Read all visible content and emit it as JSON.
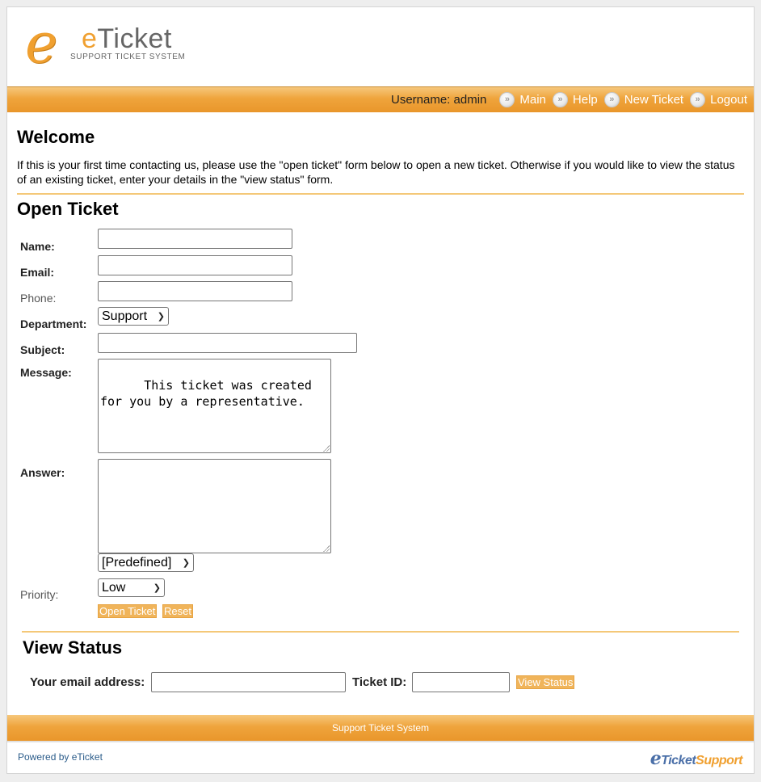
{
  "logo": {
    "letter": "e",
    "title_accent": "e",
    "title_rest": "Ticket",
    "subtitle": "SUPPORT TICKET SYSTEM"
  },
  "nav": {
    "username_text": "Username: admin",
    "links": [
      {
        "label": "Main"
      },
      {
        "label": "Help"
      },
      {
        "label": "New Ticket"
      },
      {
        "label": "Logout"
      }
    ]
  },
  "welcome": {
    "title": "Welcome",
    "text": "If this is your first time contacting us, please use the \"open ticket\" form below to open a new ticket. Otherwise if you would like to view the status of an existing ticket, enter your details in the \"view status\" form."
  },
  "open_ticket": {
    "title": "Open Ticket",
    "name_label": "Name:",
    "email_label": "Email:",
    "phone_label": "Phone:",
    "department_label": "Department:",
    "department_value": "Support",
    "subject_label": "Subject:",
    "message_label": "Message:",
    "message_value": "This ticket was created for you by a representative.",
    "answer_label": "Answer:",
    "answer_value": "",
    "predefined_value": "[Predefined]",
    "priority_label": "Priority:",
    "priority_value": "Low",
    "open_button": "Open Ticket",
    "reset_button": "Reset"
  },
  "view_status": {
    "title": "View Status",
    "email_label": "Your email address:",
    "ticket_label": "Ticket ID:",
    "button": "View Status"
  },
  "footer": {
    "bar_text": "Support Ticket System",
    "powered_by": "Powered by eTicket",
    "logo_e": "e",
    "logo_ticket": "Ticket",
    "logo_support": "Support"
  },
  "colors": {
    "accent": "#efa43c",
    "rule": "#f4c878",
    "link": "#2b5c8a"
  },
  "icons": {
    "nav": "double-chevron-right-icon",
    "select": "chevron-down-icon",
    "resize": "resize-grip-icon"
  }
}
